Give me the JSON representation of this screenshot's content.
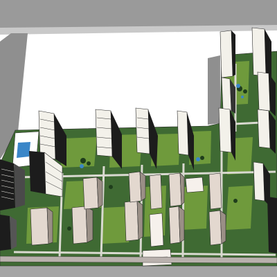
{
  "scene": {
    "kind": "3d-site-model",
    "colors": {
      "background": "#ffffff",
      "road": "#8f8f8f",
      "road_edge": "#cfcfcf",
      "ground": "#3f6a33",
      "lawn": "#6f9a3c",
      "path": "#d9d9d0",
      "tower_wall": "#f3f1ea",
      "tower_dark": "#1c1c1c",
      "low_rise": "#e3d8cf",
      "low_rise_roof": "#f6f1ec",
      "pool": "#3a86c8",
      "outline": "#2a2a2a"
    }
  }
}
